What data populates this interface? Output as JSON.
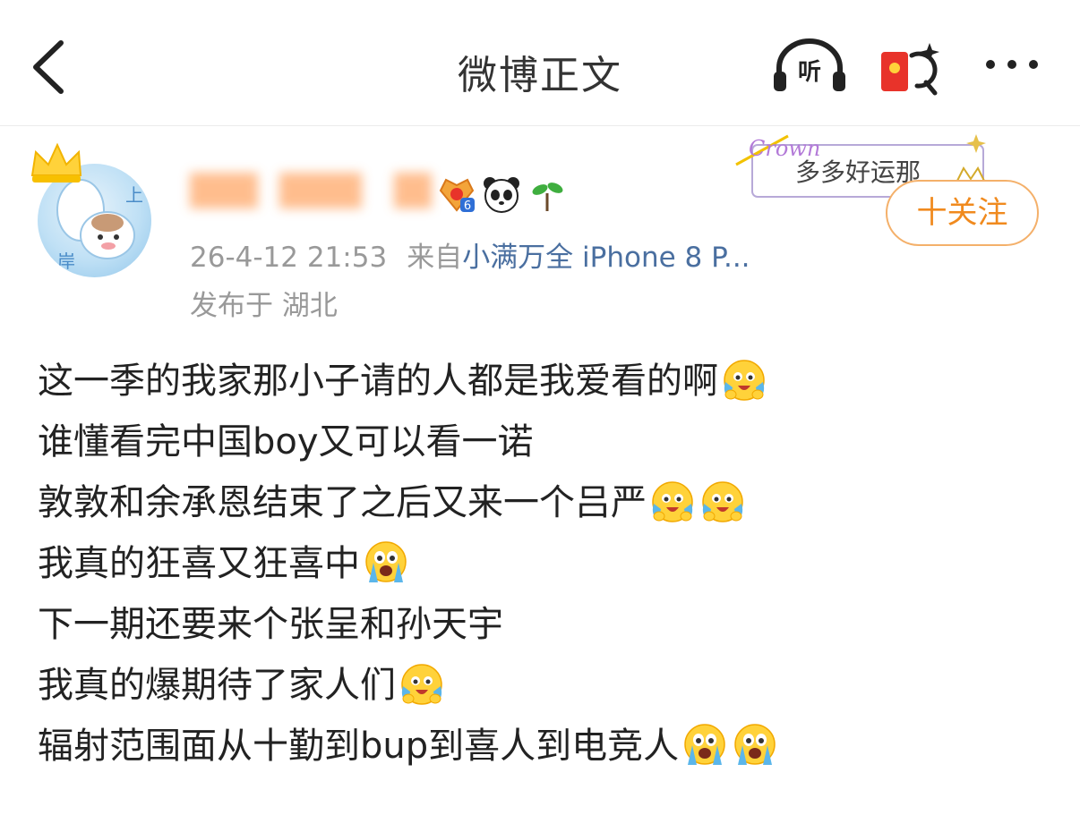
{
  "header": {
    "title": "微博正文",
    "listen_label": "听"
  },
  "post": {
    "author": {
      "avatar_text_1": "上",
      "avatar_text_2": "岸",
      "badge_level": "6"
    },
    "decoration": {
      "brand": "Crown",
      "text": "多多好运那"
    },
    "follow_label": "十关注",
    "timestamp": "26-4-12 21:53",
    "source_prefix": "来自",
    "source": "小满万全 iPhone 8 P...",
    "region": "发布于 湖北",
    "lines": [
      {
        "text": "这一季的我家那小子请的人都是我爱看的啊",
        "emojis": [
          "cry-laugh-icon"
        ]
      },
      {
        "text": "谁懂看完中国boy又可以看一诺",
        "emojis": []
      },
      {
        "text": "敦敦和余承恩结束了之后又来一个吕严",
        "emojis": [
          "cry-laugh-icon",
          "cry-laugh-icon"
        ]
      },
      {
        "text": "我真的狂喜又狂喜中",
        "emojis": [
          "crying-icon"
        ]
      },
      {
        "text": "下一期还要来个张呈和孙天宇",
        "emojis": []
      },
      {
        "text": "我真的爆期待了家人们",
        "emojis": [
          "cry-laugh-icon"
        ]
      },
      {
        "text": "辐射范围面从十勤到bup到喜人到电竞人",
        "emojis": [
          "crying-icon",
          "crying-icon"
        ]
      }
    ]
  },
  "colors": {
    "accent": "#f08a1e",
    "link": "#4a6fa0",
    "meta": "#999999"
  }
}
